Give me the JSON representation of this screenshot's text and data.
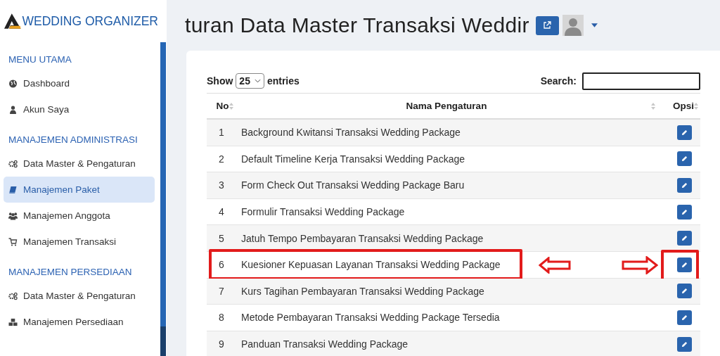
{
  "sidebar": {
    "brand": "WEDDING ORGANIZER",
    "sections": [
      {
        "title": "MENU UTAMA",
        "items": [
          {
            "label": "Dashboard",
            "selected": false
          },
          {
            "label": "Akun Saya",
            "selected": false
          }
        ]
      },
      {
        "title": "MANAJEMEN ADMINISTRASI",
        "items": [
          {
            "label": "Data Master & Pengaturan",
            "selected": false
          },
          {
            "label": "Manajemen Paket",
            "selected": true
          },
          {
            "label": "Manajemen Anggota",
            "selected": false
          },
          {
            "label": "Manajemen Transaksi",
            "selected": false
          }
        ]
      },
      {
        "title": "MANAJEMEN PERSEDIAAN",
        "items": [
          {
            "label": "Data Master & Pengaturan",
            "selected": false
          },
          {
            "label": "Manajemen Persediaan",
            "selected": false
          }
        ]
      }
    ]
  },
  "page_title": "turan Data Master Transaksi Weddir",
  "table_controls": {
    "show_label": "Show",
    "page_size": "25",
    "entries_label": "entries",
    "search_label": "Search:"
  },
  "table": {
    "columns": [
      "No",
      "Nama Pengaturan",
      "Opsi"
    ],
    "rows": [
      {
        "no": "1",
        "name": "Background Kwitansi Transaksi Wedding Package",
        "highlighted": false
      },
      {
        "no": "2",
        "name": "Default Timeline Kerja Transaksi Wedding Package",
        "highlighted": false
      },
      {
        "no": "3",
        "name": "Form Check Out Transaksi Wedding Package Baru",
        "highlighted": false
      },
      {
        "no": "4",
        "name": "Formulir Transaksi Wedding Package",
        "highlighted": false
      },
      {
        "no": "5",
        "name": "Jatuh Tempo Pembayaran Transaksi Wedding Package",
        "highlighted": false
      },
      {
        "no": "6",
        "name": "Kuesioner Kepuasan Layanan Transaksi Wedding Package",
        "highlighted": true
      },
      {
        "no": "7",
        "name": "Kurs Tagihan Pembayaran Transaksi Wedding Package",
        "highlighted": false
      },
      {
        "no": "8",
        "name": "Metode Pembayaran Transaksi Wedding Package Tersedia",
        "highlighted": false
      },
      {
        "no": "9",
        "name": "Panduan Transaksi Wedding Package",
        "highlighted": false
      }
    ]
  }
}
